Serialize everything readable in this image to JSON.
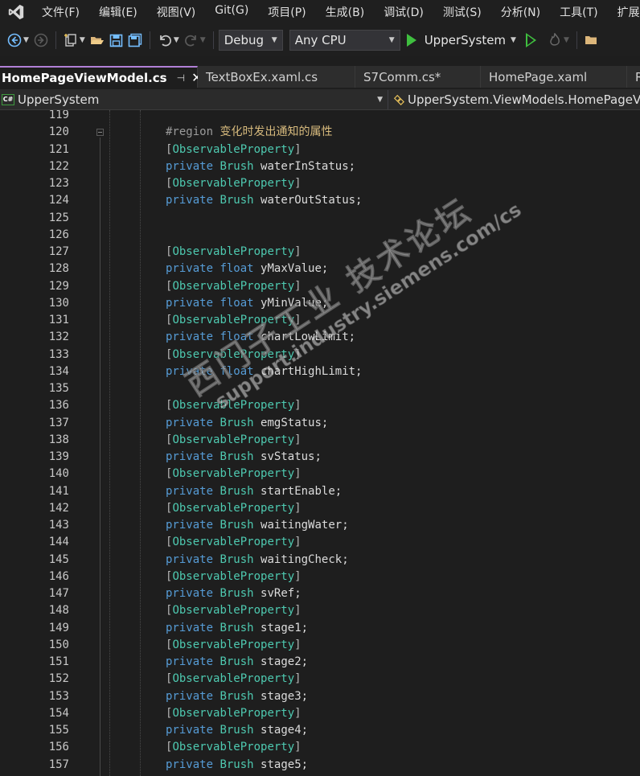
{
  "menu": {
    "items": [
      "文件(F)",
      "编辑(E)",
      "视图(V)",
      "Git(G)",
      "项目(P)",
      "生成(B)",
      "调试(D)",
      "测试(S)",
      "分析(N)",
      "工具(T)",
      "扩展"
    ]
  },
  "toolbar": {
    "configuration": "Debug",
    "platform": "Any CPU",
    "start_project": "UpperSystem"
  },
  "tabs": [
    {
      "label": "HomePageViewModel.cs",
      "active": true
    },
    {
      "label": "TextBoxEx.xaml.cs",
      "active": false
    },
    {
      "label": "S7Comm.cs*",
      "active": false
    },
    {
      "label": "HomePage.xaml",
      "active": false
    },
    {
      "label": "R",
      "active": false
    }
  ],
  "tab_pin_glyph": "⊣",
  "tab_close_glyph": "✕",
  "navbar": {
    "project_badge": "C#",
    "project": "UpperSystem",
    "type": "UpperSystem.ViewModels.HomePageV"
  },
  "editor": {
    "lines": [
      {
        "n": "119",
        "kind": "blank"
      },
      {
        "n": "120",
        "kind": "region",
        "keyword": "#region",
        "name": "变化时发出通知的属性"
      },
      {
        "n": "121",
        "kind": "attr",
        "attr": "ObservableProperty"
      },
      {
        "n": "122",
        "kind": "field",
        "modifier": "private",
        "type": "Brush",
        "name": "waterInStatus;"
      },
      {
        "n": "123",
        "kind": "attr",
        "attr": "ObservableProperty"
      },
      {
        "n": "124",
        "kind": "field",
        "modifier": "private",
        "type": "Brush",
        "name": "waterOutStatus;"
      },
      {
        "n": "125",
        "kind": "blank"
      },
      {
        "n": "126",
        "kind": "blank"
      },
      {
        "n": "127",
        "kind": "attr",
        "attr": "ObservableProperty"
      },
      {
        "n": "128",
        "kind": "field",
        "modifier": "private",
        "type": "float",
        "name": "yMaxValue;"
      },
      {
        "n": "129",
        "kind": "attr",
        "attr": "ObservableProperty"
      },
      {
        "n": "130",
        "kind": "field",
        "modifier": "private",
        "type": "float",
        "name": "yMinValue;"
      },
      {
        "n": "131",
        "kind": "attr",
        "attr": "ObservableProperty"
      },
      {
        "n": "132",
        "kind": "field",
        "modifier": "private",
        "type": "float",
        "name": "chartLowLimit;"
      },
      {
        "n": "133",
        "kind": "attr",
        "attr": "ObservableProperty"
      },
      {
        "n": "134",
        "kind": "field",
        "modifier": "private",
        "type": "float",
        "name": "chartHighLimit;"
      },
      {
        "n": "135",
        "kind": "blank"
      },
      {
        "n": "136",
        "kind": "attr",
        "attr": "ObservableProperty"
      },
      {
        "n": "137",
        "kind": "field",
        "modifier": "private",
        "type": "Brush",
        "name": "emgStatus;"
      },
      {
        "n": "138",
        "kind": "attr",
        "attr": "ObservableProperty"
      },
      {
        "n": "139",
        "kind": "field",
        "modifier": "private",
        "type": "Brush",
        "name": "svStatus;"
      },
      {
        "n": "140",
        "kind": "attr",
        "attr": "ObservableProperty"
      },
      {
        "n": "141",
        "kind": "field",
        "modifier": "private",
        "type": "Brush",
        "name": "startEnable;"
      },
      {
        "n": "142",
        "kind": "attr",
        "attr": "ObservableProperty"
      },
      {
        "n": "143",
        "kind": "field",
        "modifier": "private",
        "type": "Brush",
        "name": "waitingWater;"
      },
      {
        "n": "144",
        "kind": "attr",
        "attr": "ObservableProperty"
      },
      {
        "n": "145",
        "kind": "field",
        "modifier": "private",
        "type": "Brush",
        "name": "waitingCheck;"
      },
      {
        "n": "146",
        "kind": "attr",
        "attr": "ObservableProperty"
      },
      {
        "n": "147",
        "kind": "field",
        "modifier": "private",
        "type": "Brush",
        "name": "svRef;"
      },
      {
        "n": "148",
        "kind": "attr",
        "attr": "ObservableProperty"
      },
      {
        "n": "149",
        "kind": "field",
        "modifier": "private",
        "type": "Brush",
        "name": "stage1;"
      },
      {
        "n": "150",
        "kind": "attr",
        "attr": "ObservableProperty"
      },
      {
        "n": "151",
        "kind": "field",
        "modifier": "private",
        "type": "Brush",
        "name": "stage2;"
      },
      {
        "n": "152",
        "kind": "attr",
        "attr": "ObservableProperty"
      },
      {
        "n": "153",
        "kind": "field",
        "modifier": "private",
        "type": "Brush",
        "name": "stage3;"
      },
      {
        "n": "154",
        "kind": "attr",
        "attr": "ObservableProperty"
      },
      {
        "n": "155",
        "kind": "field",
        "modifier": "private",
        "type": "Brush",
        "name": "stage4;"
      },
      {
        "n": "156",
        "kind": "attr",
        "attr": "ObservableProperty"
      },
      {
        "n": "157",
        "kind": "field",
        "modifier": "private",
        "type": "Brush",
        "name": "stage5;"
      }
    ]
  },
  "watermark": {
    "line1": "西门子工业 技术论坛",
    "line2": "support.industry.siemens.com/cs"
  },
  "colors": {
    "keyword": "#569cd6",
    "type": "#4ec9b0",
    "region_name": "#d7ba7d",
    "run_green": "#3fbf3f",
    "active_tab_accent": "#b180d7"
  }
}
